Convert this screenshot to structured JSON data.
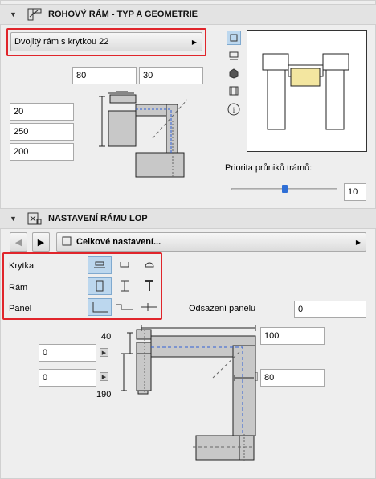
{
  "section1": {
    "title": "ROHOVÝ RÁM - TYP A GEOMETRIE",
    "preset": "Dvojitý rám s krytkou 22",
    "fields": {
      "top_left": "80",
      "top_right": "30",
      "left_1": "20",
      "left_2": "250",
      "left_3": "200"
    },
    "priority_label": "Priorita průniků trámů:",
    "priority_value": "10",
    "priority_slider_fraction": 0.5
  },
  "section2": {
    "title": "NASTAVENÍ RÁMU LOP",
    "nav_page": "Celkové nastavení...",
    "rows": [
      "Krytka",
      "Rám",
      "Panel"
    ],
    "offset_label": "Odsazení panelu",
    "offset_value": "0",
    "dims": {
      "top_left": "40",
      "top_right_field": "100",
      "left_field_1": "0",
      "left_field_2": "0",
      "right_field": "80",
      "bottom_left": "190"
    }
  },
  "colors": {
    "highlight": "#e0252b",
    "selected": "#bcd7ee",
    "fill": "#c8c8c8",
    "dashed": "#2f5fd6"
  }
}
